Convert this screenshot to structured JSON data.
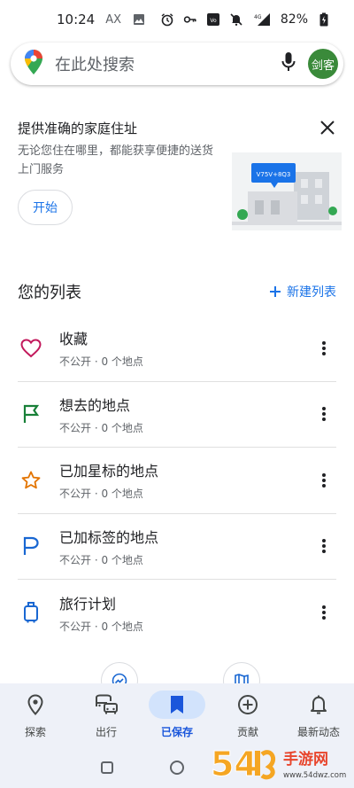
{
  "status_bar": {
    "time": "10:24",
    "indicator": "AX",
    "network": "4G",
    "battery": "82%"
  },
  "search": {
    "placeholder": "在此处搜索",
    "avatar_text": "剑客"
  },
  "promo": {
    "title": "提供准确的家庭住址",
    "description": "无论您住在哪里，都能获享便捷的送货上门服务",
    "button": "开始",
    "plus_code": "V75V+8Q3"
  },
  "lists": {
    "title": "您的列表",
    "new_list": "新建列表",
    "items": [
      {
        "title": "收藏",
        "subtitle": "不公开 · 0 个地点",
        "icon": "heart-icon",
        "color": "#c2185b"
      },
      {
        "title": "想去的地点",
        "subtitle": "不公开 · 0 个地点",
        "icon": "flag-icon",
        "color": "#188038"
      },
      {
        "title": "已加星标的地点",
        "subtitle": "不公开 · 0 个地点",
        "icon": "star-icon",
        "color": "#e37400"
      },
      {
        "title": "已加标签的地点",
        "subtitle": "不公开 · 0 个地点",
        "icon": "label-flag-icon",
        "color": "#1967d2"
      },
      {
        "title": "旅行计划",
        "subtitle": "不公开 · 0 个地点",
        "icon": "luggage-icon",
        "color": "#1967d2"
      }
    ]
  },
  "bottom_nav": [
    {
      "label": "探索",
      "icon": "location-pin-icon"
    },
    {
      "label": "出行",
      "icon": "commute-icon"
    },
    {
      "label": "已保存",
      "icon": "bookmark-icon",
      "active": true
    },
    {
      "label": "贡献",
      "icon": "add-circle-icon"
    },
    {
      "label": "最新动态",
      "icon": "bell-icon"
    }
  ],
  "watermark": {
    "digits": "54",
    "text": "手游网",
    "domain": "www.54dwz.com"
  },
  "colors": {
    "accent": "#1a73e8",
    "active_nav_bg": "#d2e3fc",
    "nav_bg": "#eef1f8",
    "avatar_bg": "#3a8a3a"
  }
}
